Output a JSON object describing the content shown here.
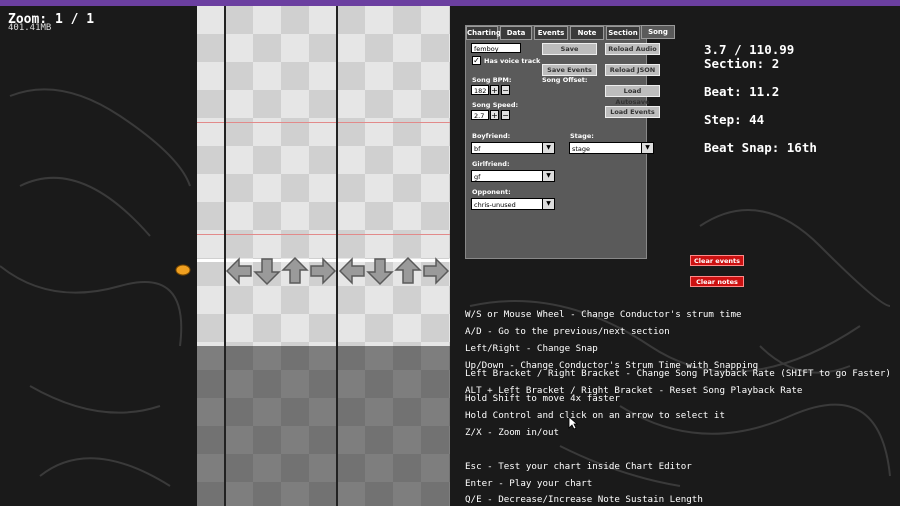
{
  "window": {
    "accent": "#6b3fa0"
  },
  "stats": {
    "zoom": "Zoom: 1 / 1",
    "memory": "401.41MB"
  },
  "tabs": [
    {
      "label": "Charting"
    },
    {
      "label": "Data"
    },
    {
      "label": "Events"
    },
    {
      "label": "Note"
    },
    {
      "label": "Section"
    },
    {
      "label": "Song",
      "active": true
    }
  ],
  "song_tab": {
    "song_name": "femboy",
    "has_voice_track_label": "Has voice track",
    "has_voice_track_checked": true,
    "save_label": "Save",
    "reload_audio_label": "Reload Audio",
    "save_events_label": "Save Events",
    "reload_json_label": "Reload JSON",
    "song_offset_label": "Song Offset:",
    "song_bpm_label": "Song BPM:",
    "song_bpm_value": "182",
    "song_speed_label": "Song Speed:",
    "song_speed_value": "2.7",
    "load_autosave_label": "Load Autosave",
    "load_events_label": "Load Events",
    "plus": "+",
    "minus": "−",
    "boyfriend_label": "Boyfriend:",
    "boyfriend_value": "bf",
    "stage_label": "Stage:",
    "stage_value": "stage",
    "girlfriend_label": "Girlfriend:",
    "girlfriend_value": "gf",
    "opponent_label": "Opponent:",
    "opponent_value": "chris-unused"
  },
  "info": {
    "time": "3.7 / 110.99",
    "section": "Section: 2",
    "beat": "Beat: 11.2",
    "step": "Step: 44",
    "beat_snap": "Beat Snap: 16th"
  },
  "clear_events_label": "Clear events",
  "clear_notes_label": "Clear notes",
  "help_lines": [
    "W/S or Mouse Wheel - Change Conductor's strum time",
    "A/D - Go to the previous/next section",
    "Left/Right - Change Snap",
    "Up/Down - Change Conductor's Strum Time with Snapping",
    "Left Bracket / Right Bracket - Change Song Playback Rate (SHIFT to go Faster)",
    "ALT + Left Bracket / Right Bracket - Reset Song Playback Rate",
    "Hold Shift to move 4x faster",
    "Hold Control and click on an arrow to select it",
    "Z/X - Zoom in/out",
    "Esc - Test your chart inside Chart Editor",
    "Enter - Play your chart",
    "Q/E - Decrease/Increase Note Sustain Length"
  ],
  "colors": {
    "panel": "#5a5a5a",
    "clear_button": "#cc1111",
    "grid_line": "#e28a8a"
  }
}
